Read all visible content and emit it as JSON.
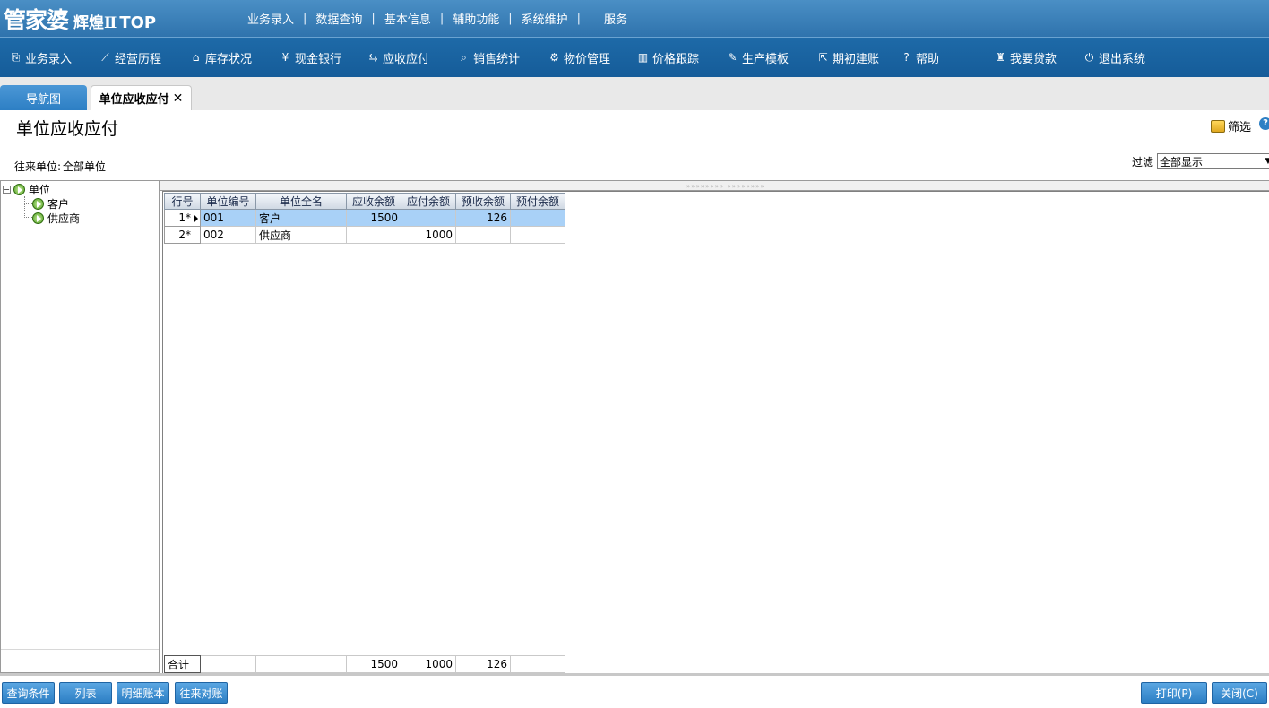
{
  "brand": {
    "name": "管家婆",
    "edition": "辉煌Ⅱ",
    "suffix": "TOP"
  },
  "top_menu": [
    "业务录入",
    "数据查询",
    "基本信息",
    "辅助功能",
    "系统维护",
    "服务"
  ],
  "top_menu_separator": "|",
  "nav": [
    {
      "icon": "entry-icon",
      "glyph": "⎘",
      "label": "业务录入"
    },
    {
      "icon": "trend-icon",
      "glyph": "⟋",
      "label": "经营历程"
    },
    {
      "icon": "home-icon",
      "glyph": "⌂",
      "label": "库存状况"
    },
    {
      "icon": "yen-icon",
      "glyph": "¥",
      "label": "现金银行"
    },
    {
      "icon": "exchange-icon",
      "glyph": "⇆",
      "label": "应收应付"
    },
    {
      "icon": "search-icon",
      "glyph": "⌕",
      "label": "销售统计"
    },
    {
      "icon": "gear-icon",
      "glyph": "⚙",
      "label": "物价管理"
    },
    {
      "icon": "bar-chart-icon",
      "glyph": "▥",
      "label": "价格跟踪"
    },
    {
      "icon": "wrench-icon",
      "glyph": "✎",
      "label": "生产模板"
    },
    {
      "icon": "external-link-icon",
      "glyph": "⇱",
      "label": "期初建账"
    },
    {
      "icon": "help-icon",
      "glyph": "?",
      "label": "帮助"
    },
    {
      "icon": "money-bag-icon",
      "glyph": "♜",
      "label": "我要贷款"
    },
    {
      "icon": "power-icon",
      "glyph": "⏻",
      "label": "退出系统"
    }
  ],
  "tabs": {
    "nav_tab": "导航图",
    "active_tab": "单位应收应付",
    "close_glyph": "✕"
  },
  "page": {
    "title": "单位应收应付",
    "filter_link": "筛选",
    "party_label": "往来单位:",
    "party_value": "全部单位",
    "filter_label": "过滤",
    "filter_value": "全部显示"
  },
  "tree": {
    "root": "单位",
    "root_expander": "⊟",
    "children": [
      "客户",
      "供应商"
    ]
  },
  "grid": {
    "columns": [
      "行号",
      "单位编号",
      "单位全名",
      "应收余额",
      "应付余额",
      "预收余额",
      "预付余额"
    ],
    "rows": [
      {
        "rn": "1*",
        "code": "001",
        "name": "客户",
        "receivable": "1500",
        "payable": "",
        "advance_received": "126",
        "advance_paid": ""
      },
      {
        "rn": "2*",
        "code": "002",
        "name": "供应商",
        "receivable": "",
        "payable": "1000",
        "advance_received": "",
        "advance_paid": ""
      }
    ],
    "totals": {
      "label": "合计",
      "code": "",
      "name": "",
      "receivable": "1500",
      "payable": "1000",
      "advance_received": "126",
      "advance_paid": ""
    }
  },
  "buttons": {
    "query": "查询条件",
    "list": "列表",
    "detail": "明细账本",
    "reconcile": "往来对账",
    "print": "打印(P)",
    "close": "关闭(C)"
  }
}
